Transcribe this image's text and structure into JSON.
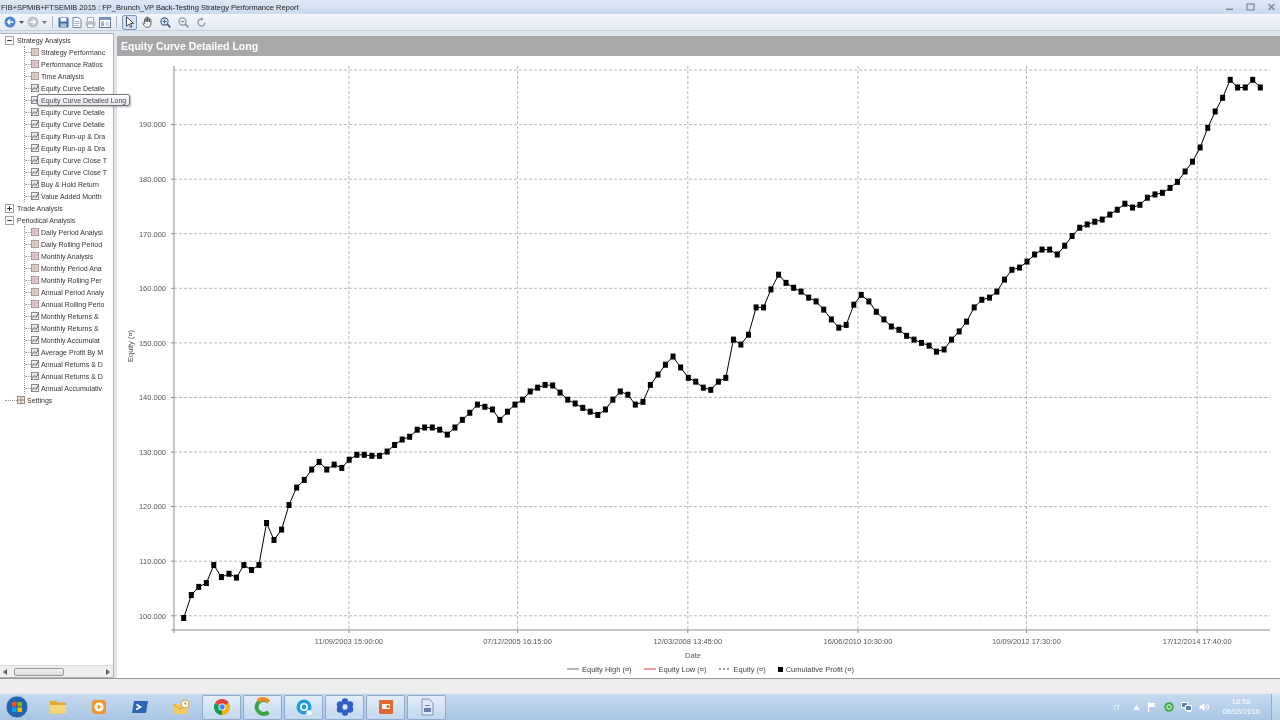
{
  "window": {
    "title": "FIB+SPMIB+FTSEMIB 2015 : FP_Brunch_VP Back-Testing Strategy Performance Report"
  },
  "toolbar": {
    "tools": [
      {
        "selected": true
      },
      {
        "selected": false
      },
      {
        "selected": false
      },
      {
        "selected": false
      },
      {
        "selected": false
      }
    ]
  },
  "tree": [
    {
      "label": "Strategy Analysis",
      "expanded": true,
      "children": [
        {
          "label": "Strategy Performanc",
          "kind": "table"
        },
        {
          "label": "Performance Ratios",
          "kind": "table"
        },
        {
          "label": "Time Analysis",
          "kind": "table"
        },
        {
          "label": "Equity Curve Detaile",
          "kind": "chart"
        },
        {
          "kind": "chart",
          "tooltip": "Equity Curve Detailed Long"
        },
        {
          "label": "Equity Curve Detaile",
          "kind": "chart"
        },
        {
          "label": "Equity Curve Detaile",
          "kind": "chart"
        },
        {
          "label": "Equity Run-up & Dra",
          "kind": "chart"
        },
        {
          "label": "Equity Run-up & Dra",
          "kind": "chart"
        },
        {
          "label": "Equity Curve Close T",
          "kind": "chart"
        },
        {
          "label": "Equity Curve Close T",
          "kind": "chart"
        },
        {
          "label": "Buy & Hold Return",
          "kind": "chart"
        },
        {
          "label": "Value Added Month",
          "kind": "chart"
        }
      ]
    },
    {
      "label": "Trade Analysis",
      "expanded": false
    },
    {
      "label": "Periodical Analysis",
      "expanded": true,
      "children": [
        {
          "label": "Daily Period Analysi",
          "kind": "table"
        },
        {
          "label": "Daily Rolling Period",
          "kind": "table"
        },
        {
          "label": "Monthly Analysis",
          "kind": "table"
        },
        {
          "label": "Monthly Period Ana",
          "kind": "table"
        },
        {
          "label": "Monthly Rolling Per",
          "kind": "table"
        },
        {
          "label": "Annual Period Analy",
          "kind": "table"
        },
        {
          "label": "Annual Rolling Perio",
          "kind": "table"
        },
        {
          "label": "Monthly Returns &",
          "kind": "chart"
        },
        {
          "label": "Monthly Returns &",
          "kind": "chart"
        },
        {
          "label": "Monthly Accumulat",
          "kind": "chart"
        },
        {
          "label": "Average Profit By M",
          "kind": "chart"
        },
        {
          "label": "Annual Returns & D",
          "kind": "chart"
        },
        {
          "label": "Annual Returns & D",
          "kind": "chart"
        },
        {
          "label": "Annual Accumulativ",
          "kind": "chart"
        }
      ]
    },
    {
      "label": "Settings",
      "kind": "settings"
    }
  ],
  "panel": {
    "title": "Equity Curve Detailed Long",
    "chart_data": {
      "type": "line",
      "xlabel": "Date",
      "ylabel": "Equity (¤)",
      "grid": true,
      "x": [
        "2001-07-02",
        "2001-08-08",
        "2001-09-13",
        "2001-10-20",
        "2001-11-25",
        "2002-01-01",
        "2002-02-07",
        "2002-03-15",
        "2002-04-20",
        "2002-05-27",
        "2002-07-02",
        "2002-08-08",
        "2002-09-13",
        "2002-10-20",
        "2002-11-25",
        "2003-01-01",
        "2003-02-07",
        "2003-03-15",
        "2003-04-20",
        "2003-05-27",
        "2003-07-02",
        "2003-08-08",
        "2003-09-13",
        "2003-10-20",
        "2003-11-25",
        "2004-01-01",
        "2004-02-07",
        "2004-03-15",
        "2004-04-20",
        "2004-05-27",
        "2004-07-02",
        "2004-08-08",
        "2004-09-13",
        "2004-10-20",
        "2004-11-25",
        "2005-01-01",
        "2005-02-07",
        "2005-03-15",
        "2005-04-20",
        "2005-05-27",
        "2005-07-02",
        "2005-08-08",
        "2005-09-13",
        "2005-10-20",
        "2005-11-25",
        "2006-01-01",
        "2006-02-07",
        "2006-03-15",
        "2006-04-20",
        "2006-05-27",
        "2006-07-02",
        "2006-08-08",
        "2006-09-13",
        "2006-10-20",
        "2006-11-25",
        "2007-01-01",
        "2007-02-07",
        "2007-03-15",
        "2007-04-20",
        "2007-05-27",
        "2007-07-02",
        "2007-08-08",
        "2007-09-13",
        "2007-10-20",
        "2007-11-25",
        "2008-01-01",
        "2008-02-07",
        "2008-03-15",
        "2008-04-20",
        "2008-05-27",
        "2008-07-02",
        "2008-08-08",
        "2008-09-13",
        "2008-10-20",
        "2008-11-25",
        "2009-01-01",
        "2009-02-07",
        "2009-03-15",
        "2009-04-20",
        "2009-05-27",
        "2009-07-02",
        "2009-08-08",
        "2009-09-13",
        "2009-10-20",
        "2009-11-25",
        "2010-01-01",
        "2010-02-07",
        "2010-03-15",
        "2010-04-20",
        "2010-05-27",
        "2010-07-02",
        "2010-08-08",
        "2010-09-13",
        "2010-10-20",
        "2010-11-25",
        "2011-01-01",
        "2011-02-07",
        "2011-03-15",
        "2011-04-20",
        "2011-05-27",
        "2011-07-02",
        "2011-08-08",
        "2011-09-13",
        "2011-10-20",
        "2011-11-25",
        "2012-01-01",
        "2012-02-07",
        "2012-03-15",
        "2012-04-20",
        "2012-05-27",
        "2012-07-02",
        "2012-08-08",
        "2012-09-13",
        "2012-10-20",
        "2012-11-25",
        "2013-01-01",
        "2013-02-07",
        "2013-03-15",
        "2013-04-20",
        "2013-05-27",
        "2013-07-02",
        "2013-08-08",
        "2013-09-13",
        "2013-10-20",
        "2013-11-25",
        "2014-01-01",
        "2014-02-07",
        "2014-03-15",
        "2014-04-20",
        "2014-05-27",
        "2014-07-02",
        "2014-08-08",
        "2014-09-13",
        "2014-10-20",
        "2014-11-25",
        "2015-01-01",
        "2015-02-07",
        "2015-03-15",
        "2015-04-20",
        "2015-05-27",
        "2015-07-02",
        "2015-08-08",
        "2015-09-13",
        "2015-10-20"
      ],
      "series": [
        {
          "color": "#000000",
          "marker": "square",
          "values": [
            99600,
            103800,
            105300,
            106000,
            109300,
            107100,
            107700,
            107000,
            109300,
            108400,
            109300,
            117000,
            113900,
            115800,
            120300,
            123500,
            124900,
            126800,
            128200,
            126800,
            127700,
            127100,
            128600,
            129500,
            129500,
            129300,
            129300,
            130100,
            131300,
            132300,
            132800,
            134100,
            134500,
            134500,
            134100,
            133200,
            134500,
            135900,
            137200,
            138700,
            138300,
            137800,
            135900,
            137400,
            138700,
            139600,
            141100,
            141800,
            142300,
            142200,
            140900,
            139600,
            138900,
            138100,
            137400,
            136800,
            137800,
            139600,
            141100,
            140500,
            138700,
            139200,
            142300,
            144200,
            146000,
            147500,
            145500,
            143600,
            142900,
            141800,
            141400,
            142900,
            143600,
            150600,
            149700,
            151500,
            156500,
            156500,
            159800,
            162500,
            161000,
            160100,
            159400,
            158300,
            157600,
            156100,
            154300,
            152800,
            153300,
            157000,
            158800,
            157600,
            155700,
            154300,
            153000,
            152400,
            151300,
            150600,
            150000,
            149500,
            148400,
            148800,
            150600,
            152100,
            153900,
            156500,
            157900,
            158300,
            159400,
            161600,
            163400,
            163800,
            164900,
            166200,
            167100,
            167100,
            166200,
            167800,
            169600,
            171100,
            171700,
            172200,
            172600,
            173500,
            174400,
            175500,
            174800,
            175300,
            176600,
            177200,
            177500,
            178400,
            179500,
            181400,
            183200,
            185800,
            189400,
            192400,
            194900,
            198200,
            196800,
            196800,
            198200,
            196800
          ]
        }
      ],
      "xlim": [
        "2001-05-16",
        "2015-12-06"
      ],
      "ylim": [
        97400,
        200000
      ],
      "xticks": [
        {
          "value": "2003-09-11T15:00",
          "label": "11/09/2003 15:00:00"
        },
        {
          "value": "2005-12-07T16:15",
          "label": "07/12/2005 16:15:00"
        },
        {
          "value": "2008-03-12T13:45",
          "label": "12/03/2008 13:45:00"
        },
        {
          "value": "2010-06-16T10:30",
          "label": "16/06/2010 10:30:00"
        },
        {
          "value": "2012-09-10T17:30",
          "label": "10/09/2012 17:30:00"
        },
        {
          "value": "2014-12-17T17:40",
          "label": "17/12/2014 17:40:00"
        }
      ],
      "yticks": [
        {
          "value": 100000,
          "label": "100.000"
        },
        {
          "value": 110000,
          "label": "110.000"
        },
        {
          "value": 120000,
          "label": "120.000"
        },
        {
          "value": 130000,
          "label": "130.000"
        },
        {
          "value": 140000,
          "label": "140.000"
        },
        {
          "value": 150000,
          "label": "150.000"
        },
        {
          "value": 160000,
          "label": "160.000"
        },
        {
          "value": 170000,
          "label": "170.000"
        },
        {
          "value": 180000,
          "label": "180.000"
        },
        {
          "value": 190000,
          "label": "190.000"
        }
      ]
    },
    "legend_items": [
      {
        "label": "Equity High (¤)",
        "kind": "line",
        "color": "#b4b4b4"
      },
      {
        "label": "Equity Low (¤)",
        "kind": "line",
        "color": "#f0a0a0"
      },
      {
        "label": "Equity (¤)",
        "kind": "dashed",
        "color": "#a0a0a0"
      },
      {
        "label": "Cumulative Profit (¤)",
        "kind": "marker",
        "color": "#000000"
      }
    ]
  },
  "taskbar": {
    "buttons": [
      {
        "running": false
      },
      {
        "running": false
      },
      {
        "running": false
      },
      {
        "running": false
      },
      {
        "running": true
      },
      {
        "running": true
      },
      {
        "running": true
      },
      {
        "running": true
      },
      {
        "running": true
      },
      {
        "running": true
      }
    ],
    "tray": {
      "language": "IT",
      "time": "18:58",
      "date": "08/03/2016"
    }
  }
}
